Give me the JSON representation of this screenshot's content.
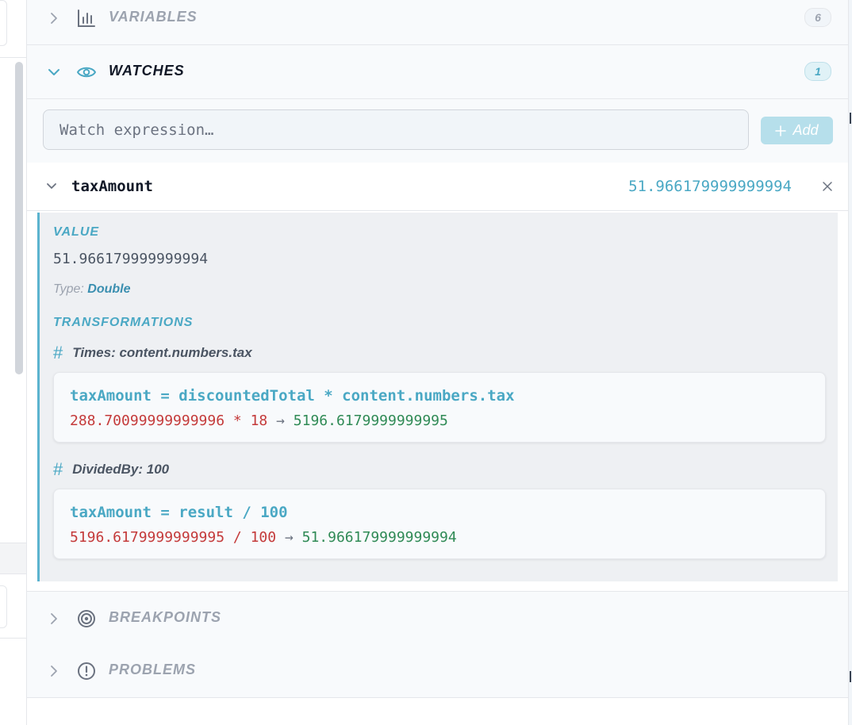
{
  "sections": {
    "variables": {
      "title": "VARIABLES",
      "count": "6",
      "expanded": false
    },
    "watches": {
      "title": "WATCHES",
      "count": "1",
      "expanded": true
    },
    "breakpoints": {
      "title": "BREAKPOINTS",
      "expanded": false
    },
    "problems": {
      "title": "PROBLEMS",
      "expanded": false
    }
  },
  "watch_input": {
    "placeholder": "Watch expression…",
    "value": ""
  },
  "add_button": {
    "label": "Add",
    "icon": "plus-icon"
  },
  "watch_item": {
    "name": "taxAmount",
    "value": "51.966179999999994",
    "detail": {
      "value_label": "VALUE",
      "value": "51.966179999999994",
      "type_label": "Type:",
      "type": "Double",
      "transformations_label": "TRANSFORMATIONS",
      "transformations": [
        {
          "title": "Times: content.numbers.tax",
          "expression": "taxAmount = discountedTotal * content.numbers.tax",
          "eval_lhs": "288.70099999999996 * 18",
          "arrow": "→",
          "eval_result": "5196.6179999999995"
        },
        {
          "title": "DividedBy: 100",
          "expression": "taxAmount = result / 100",
          "eval_lhs": "5196.6179999999995 / 100",
          "arrow": "→",
          "eval_result": "51.966179999999994"
        }
      ]
    }
  },
  "colors": {
    "accent": "#4aa8c4",
    "error_red": "#c43a3a",
    "result_green": "#2f8a55",
    "muted": "#9ca3af"
  }
}
